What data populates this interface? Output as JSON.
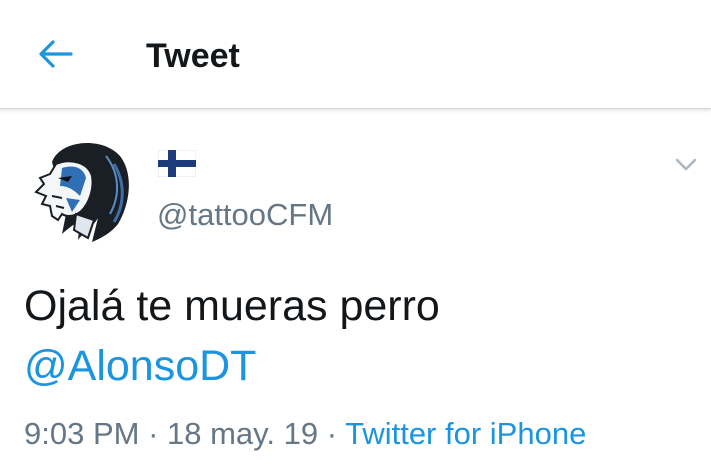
{
  "header": {
    "title": "Tweet",
    "back_icon": "arrow-left-icon"
  },
  "author": {
    "display_name_icon": "finland-flag-icon",
    "handle": "@tattooCFM"
  },
  "tweet": {
    "text": "Ojalá te mueras perro",
    "mention": "@AlonsoDT",
    "time": "9:03 PM",
    "separator": " · ",
    "date": "18 may. 19",
    "source": "Twitter for iPhone"
  },
  "colors": {
    "accent": "#1b95e0",
    "text": "#14171a",
    "muted": "#657786"
  }
}
